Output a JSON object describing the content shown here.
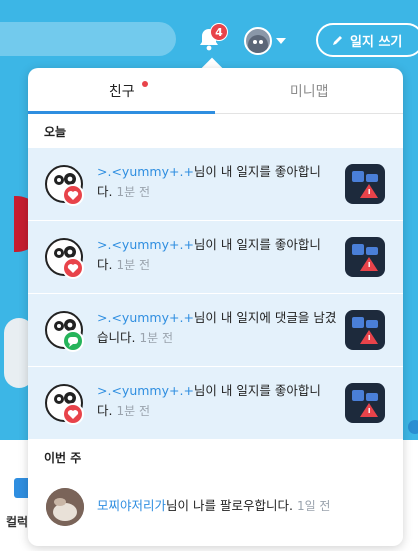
{
  "header": {
    "notification_count": "4",
    "write_button_label": "일지 쓰기"
  },
  "dropdown": {
    "tabs": [
      {
        "label": "친구",
        "active": true,
        "has_new": true
      },
      {
        "label": "미니맵",
        "active": false,
        "has_new": false
      }
    ],
    "sections": {
      "today_label": "오늘",
      "this_week_label": "이번 주"
    },
    "today": [
      {
        "user": ">.<yummy+.+",
        "message": "님이 내 일지를 좋아합니다.",
        "time": "1분 전",
        "reaction_icon": "heart-icon"
      },
      {
        "user": ">.<yummy+.+",
        "message": "님이 내 일지를 좋아합니다.",
        "time": "1분 전",
        "reaction_icon": "heart-icon"
      },
      {
        "user": ">.<yummy+.+",
        "message": "님이 내 일지에 댓글을 남겼습니다.",
        "time": "1분 전",
        "reaction_icon": "comment-icon"
      },
      {
        "user": ">.<yummy+.+",
        "message": "님이 내 일지를 좋아합니다.",
        "time": "1분 전",
        "reaction_icon": "heart-icon"
      }
    ],
    "this_week": [
      {
        "user": "모찌야저리가",
        "message": "님이 나를 팔로우합니다.",
        "time": "1일 전"
      }
    ]
  },
  "background": {
    "bottom_text": "컬럭"
  },
  "colors": {
    "page_bg": "#3cb6e6",
    "accent": "#2f8ee0",
    "badge": "#e8434a",
    "unread_row": "#e4f1fb",
    "heart": "#e8434a",
    "comment": "#25b45a"
  }
}
